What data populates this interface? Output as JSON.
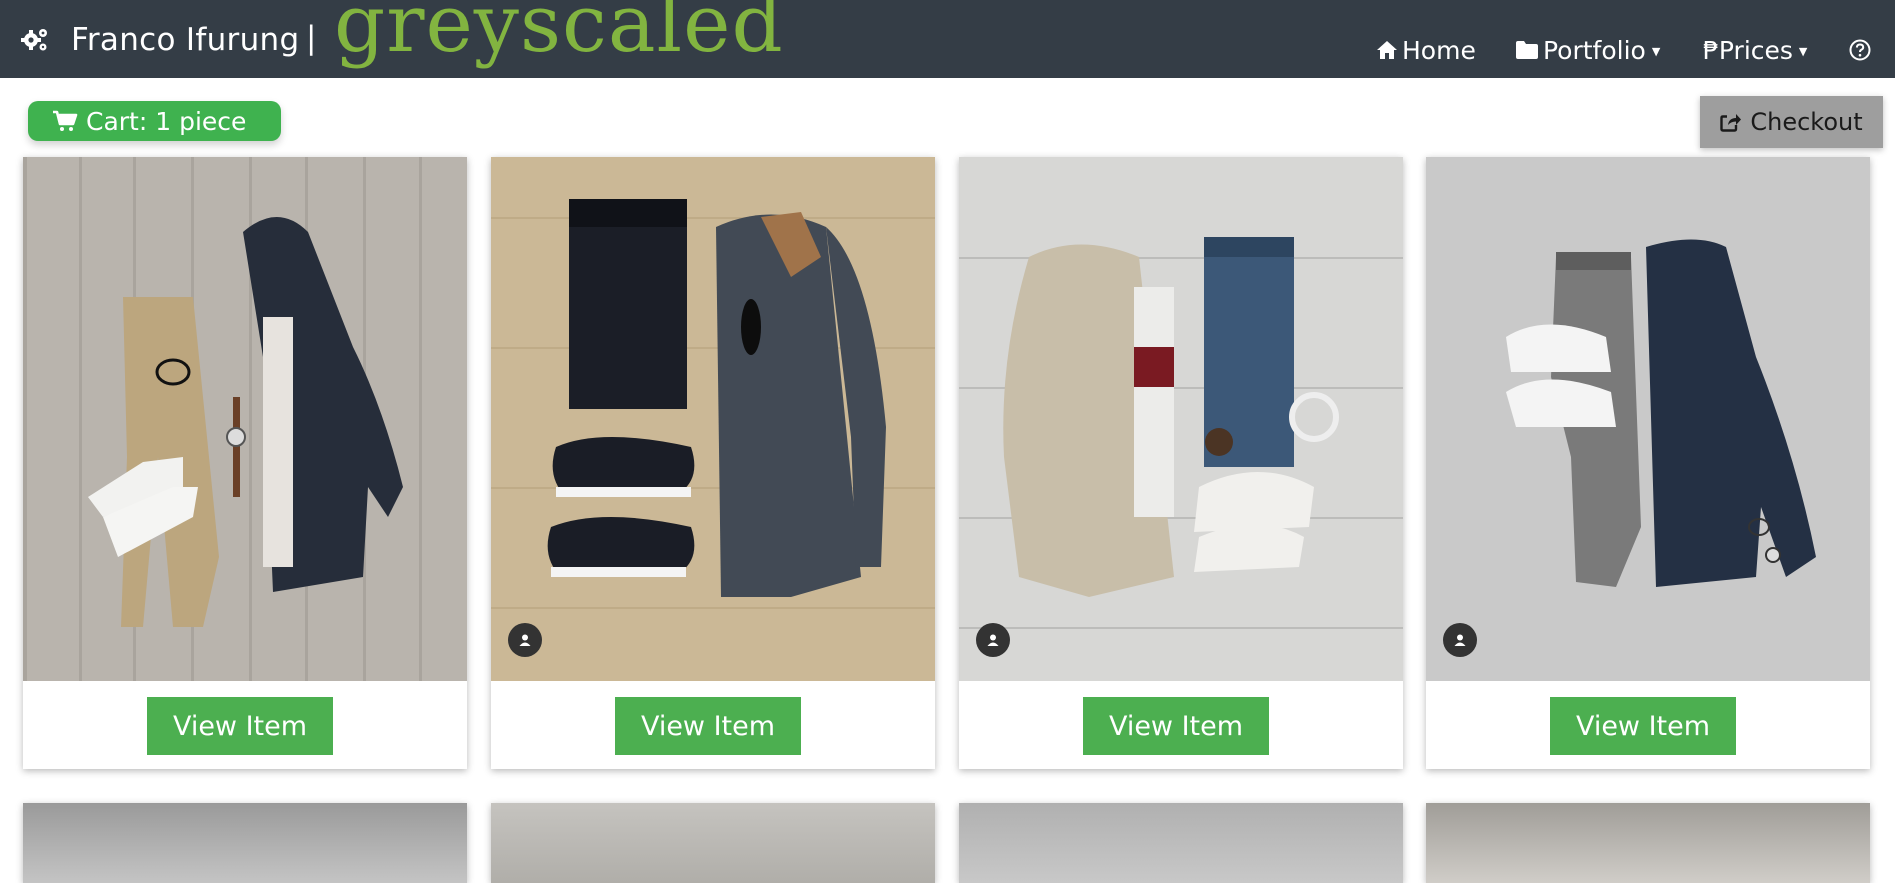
{
  "header": {
    "site_name": "Franco Ifurung",
    "separator": "|",
    "logo_text": "greyscaled",
    "logo_color": "#82b440",
    "bar_color": "#343d46",
    "nav": [
      {
        "label": "Home",
        "icon": "home-icon"
      },
      {
        "label": "Portfolio",
        "icon": "folder-icon",
        "dropdown": true
      },
      {
        "label": "Prices",
        "icon": "peso-icon",
        "prefix": "₱",
        "dropdown": true
      },
      {
        "label": "",
        "icon": "help-icon"
      }
    ]
  },
  "toolbar": {
    "cart_label": "Cart: 1 piece",
    "cart_color": "#3fb24f",
    "checkout_label": "Checkout"
  },
  "items": [
    {
      "button": "View Item"
    },
    {
      "button": "View Item"
    },
    {
      "button": "View Item"
    },
    {
      "button": "View Item"
    }
  ]
}
